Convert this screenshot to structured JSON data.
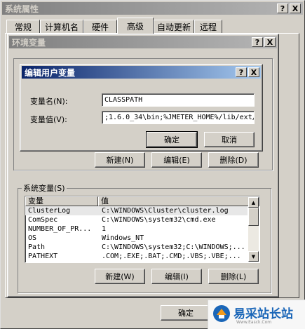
{
  "sysprops": {
    "title": "系统属性",
    "title_buttons": [
      "?",
      "X"
    ],
    "tabs": [
      "常规",
      "计算机名",
      "硬件",
      "高级",
      "自动更新",
      "远程"
    ],
    "active_tab": 3,
    "ok_label": "确定"
  },
  "envvars": {
    "title": "环境变量",
    "title_buttons": [
      "?",
      "X"
    ],
    "user_buttons": [
      "新建(N)",
      "编辑(E)",
      "删除(D)"
    ],
    "system_group_label": "系统变量(S)",
    "columns": [
      "变量",
      "值"
    ],
    "system_rows": [
      {
        "name": "ClusterLog",
        "value": "C:\\WINDOWS\\Cluster\\cluster.log"
      },
      {
        "name": "ComSpec",
        "value": "C:\\WINDOWS\\system32\\cmd.exe"
      },
      {
        "name": "NUMBER_OF_PR...",
        "value": "1"
      },
      {
        "name": "OS",
        "value": "Windows_NT"
      },
      {
        "name": "Path",
        "value": "C:\\WINDOWS\\system32;C:\\WINDOWS;..."
      },
      {
        "name": "PATHEXT",
        "value": ".COM;.EXE;.BAT;.CMD;.VBS;.VBE;..."
      }
    ],
    "system_buttons": [
      "新建(W)",
      "编辑(I)",
      "删除(L)"
    ]
  },
  "edit_dialog": {
    "title": "编辑用户变量",
    "title_buttons": [
      "?",
      "X"
    ],
    "name_label": "变量名(N):",
    "name_value": "CLASSPATH",
    "value_label": "变量值(V):",
    "value_value": ";1.6.0_34\\bin;%JMETER_HOME%/lib/ext/",
    "ok_label": "确定",
    "cancel_label": "取消"
  },
  "watermark": {
    "brand": "易采站长站",
    "url": "Www.Easck.Com"
  }
}
